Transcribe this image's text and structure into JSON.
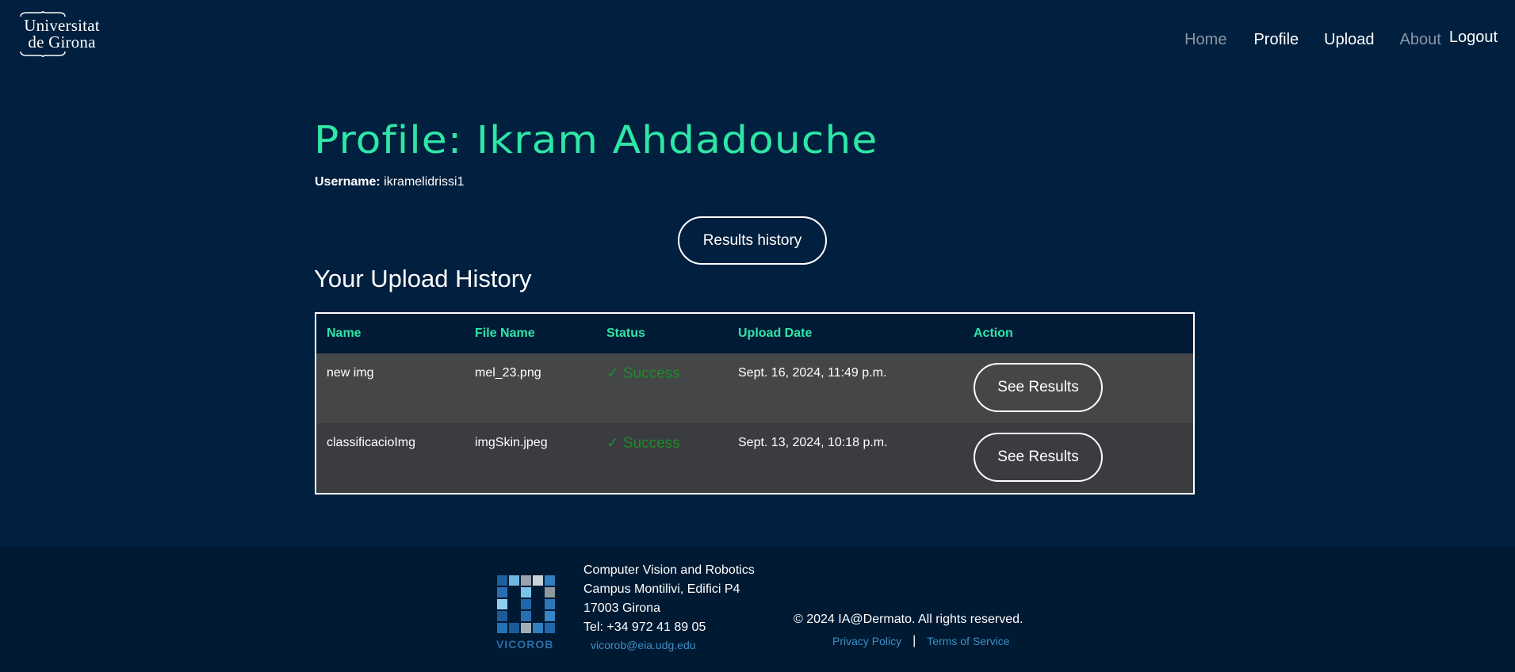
{
  "header": {
    "logo": {
      "line1": "Universitat",
      "line2": "de Girona"
    },
    "nav": {
      "home": "Home",
      "profile": "Profile",
      "upload": "Upload",
      "about": "About",
      "logout": "Logout"
    }
  },
  "profile": {
    "title": "Profile: Ikram Ahdadouche",
    "username_label": "Username:",
    "username_value": "ikramelidrissi1",
    "results_history_button": "Results history"
  },
  "upload_history": {
    "title": "Your Upload History",
    "columns": [
      "Name",
      "File Name",
      "Status",
      "Upload Date",
      "Action"
    ],
    "rows": [
      {
        "name": "new img",
        "file_name": "mel_23.png",
        "status": "Success",
        "upload_date": "Sept. 16, 2024, 11:49 p.m.",
        "action": "See Results"
      },
      {
        "name": "classificacioImg",
        "file_name": "imgSkin.jpeg",
        "status": "Success",
        "upload_date": "Sept. 13, 2024, 10:18 p.m.",
        "action": "See Results"
      }
    ],
    "status_check_glyph": "✓"
  },
  "footer": {
    "logo_label": "VICOROB",
    "address": [
      "Computer Vision and Robotics",
      "Campus Montilivi, Edifici P4",
      "17003 Girona",
      "Tel: +34 972 41 89 05"
    ],
    "email": "vicorob@eia.udg.edu",
    "copyright": "© 2024 IA@Dermato. All rights reserved.",
    "privacy_policy": "Privacy Policy",
    "terms_of_service": "Terms of Service",
    "separator": "|"
  },
  "colors": {
    "background": "#011f3e",
    "accent": "#2ee6a6",
    "success": "#1f8a2c",
    "link": "#3d8fc2",
    "footer_background": "#001a33"
  }
}
